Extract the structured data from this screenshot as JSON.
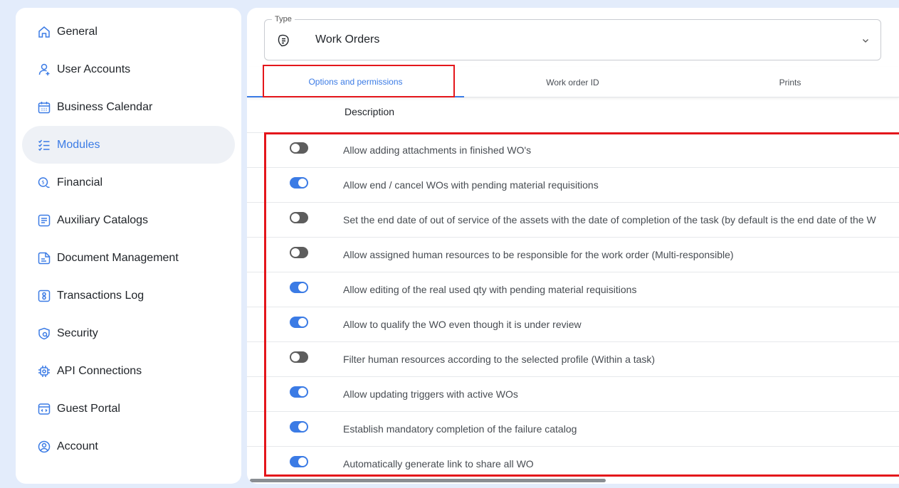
{
  "sidebar": {
    "items": [
      {
        "label": "General",
        "icon": "home-icon",
        "active": false
      },
      {
        "label": "User Accounts",
        "icon": "user-add-icon",
        "active": false
      },
      {
        "label": "Business Calendar",
        "icon": "calendar-icon",
        "active": false
      },
      {
        "label": "Modules",
        "icon": "checklist-icon",
        "active": true
      },
      {
        "label": "Financial",
        "icon": "coins-icon",
        "active": false
      },
      {
        "label": "Auxiliary Catalogs",
        "icon": "catalog-icon",
        "active": false
      },
      {
        "label": "Document Management",
        "icon": "document-icon",
        "active": false
      },
      {
        "label": "Transactions Log",
        "icon": "log-icon",
        "active": false
      },
      {
        "label": "Security",
        "icon": "shield-icon",
        "active": false
      },
      {
        "label": "API Connections",
        "icon": "api-gear-icon",
        "active": false
      },
      {
        "label": "Guest Portal",
        "icon": "portal-icon",
        "active": false
      },
      {
        "label": "Account",
        "icon": "account-circle-icon",
        "active": false
      }
    ]
  },
  "type_select": {
    "legend": "Type",
    "value": "Work Orders",
    "icon": "work-order-icon"
  },
  "tabs": [
    {
      "label": "Options and permissions",
      "active": true
    },
    {
      "label": "Work order ID",
      "active": false
    },
    {
      "label": "Prints",
      "active": false
    }
  ],
  "table": {
    "header": "Description",
    "rows": [
      {
        "text": "Allow adding attachments in finished WO's",
        "enabled": false
      },
      {
        "text": "Allow end / cancel WOs with pending material requisitions",
        "enabled": true
      },
      {
        "text": "Set the end date of out of service of the assets with the date of completion of the task (by default is the end date of the W",
        "enabled": false
      },
      {
        "text": "Allow assigned human resources to be responsible for the work order (Multi-responsible)",
        "enabled": false
      },
      {
        "text": "Allow editing of the real used qty with pending material requisitions",
        "enabled": true
      },
      {
        "text": "Allow to qualify the WO even though it is under review",
        "enabled": true
      },
      {
        "text": "Filter human resources according to the selected profile (Within a task)",
        "enabled": false
      },
      {
        "text": "Allow updating triggers with active WOs",
        "enabled": true
      },
      {
        "text": "Establish mandatory completion of the failure catalog",
        "enabled": true
      },
      {
        "text": "Automatically generate link to share all WO",
        "enabled": true
      }
    ]
  },
  "colors": {
    "accent": "#3b7be5",
    "highlight": "#e4161b",
    "toggle_off": "#5d5d5d"
  }
}
